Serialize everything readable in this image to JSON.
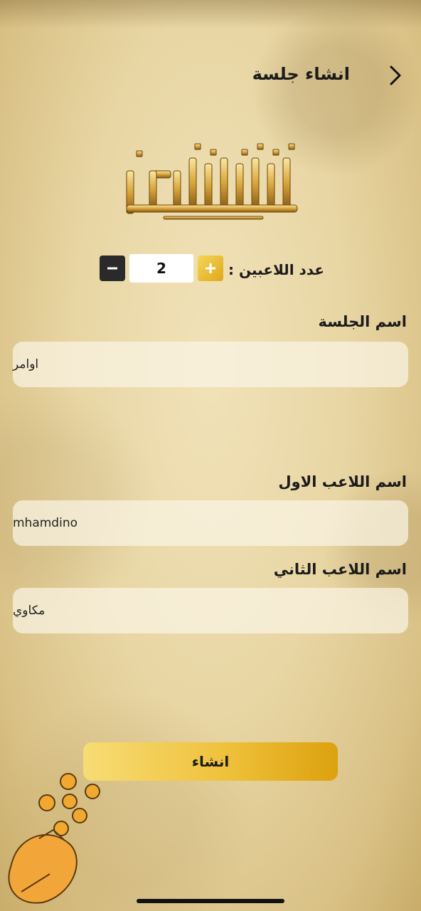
{
  "header": {
    "title": "انشاء جلسة",
    "back_icon": "chevron-right-icon"
  },
  "logo": {
    "text": "شنشون"
  },
  "players_count": {
    "label": "عدد اللاعبين :",
    "value": "2",
    "plus_icon": "plus-icon",
    "minus_icon": "minus-icon"
  },
  "session": {
    "label": "اسم الجلسة",
    "value": "اوامر"
  },
  "player1": {
    "label": "اسم اللاعب الاول",
    "value": "mhamdino"
  },
  "player2": {
    "label": "اسم اللاعب الثاني",
    "value": "مكاوي"
  },
  "create_button": {
    "label": "انشاء"
  },
  "colors": {
    "accent_gold": "#efc23c",
    "minus_button": "#2a2a2a",
    "background": "#e8d6a4"
  }
}
